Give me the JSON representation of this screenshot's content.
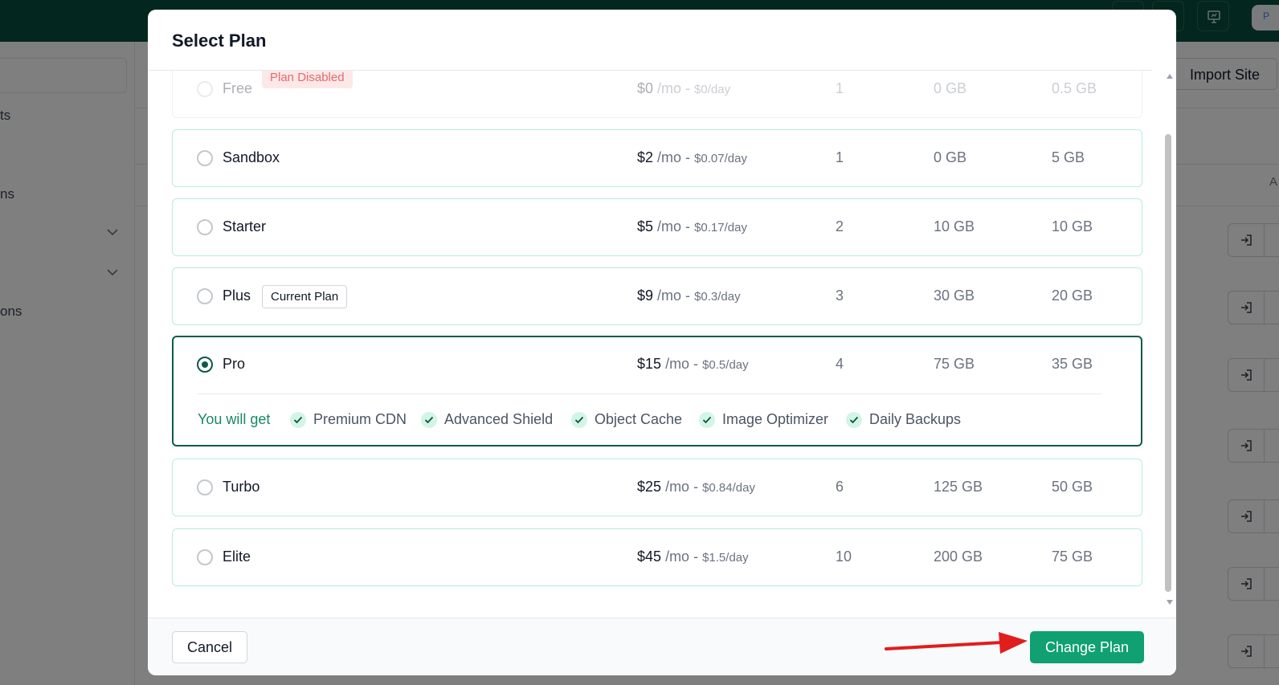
{
  "background": {
    "topbar": {
      "avatar_initial": "P"
    },
    "sidebar": {
      "items": [
        {
          "label": "ts"
        },
        {
          "label": "ns"
        },
        {
          "label": "ons"
        }
      ]
    },
    "header": {
      "import_label": "Import Site"
    },
    "table": {
      "column_fragment": "A"
    }
  },
  "modal": {
    "title": "Select Plan",
    "plans": [
      {
        "name": "Free",
        "badge": "Plan Disabled",
        "price": "$0",
        "per": "/mo - ",
        "day": "$0/day",
        "v1": "1",
        "v2": "0 GB",
        "v3": "0.5 GB"
      },
      {
        "name": "Sandbox",
        "price": "$2",
        "per": "/mo - ",
        "day": "$0.07/day",
        "v1": "1",
        "v2": "0 GB",
        "v3": "5 GB"
      },
      {
        "name": "Starter",
        "price": "$5",
        "per": "/mo - ",
        "day": "$0.17/day",
        "v1": "2",
        "v2": "10 GB",
        "v3": "10 GB"
      },
      {
        "name": "Plus",
        "badge": "Current Plan",
        "price": "$9",
        "per": "/mo - ",
        "day": "$0.3/day",
        "v1": "3",
        "v2": "30 GB",
        "v3": "20 GB"
      },
      {
        "name": "Pro",
        "price": "$15",
        "per": "/mo - ",
        "day": "$0.5/day",
        "v1": "4",
        "v2": "75 GB",
        "v3": "35 GB",
        "you_will_get": "You will get",
        "features": [
          "Premium CDN",
          "Advanced Shield",
          "Object Cache",
          "Image Optimizer",
          "Daily Backups"
        ]
      },
      {
        "name": "Turbo",
        "price": "$25",
        "per": "/mo - ",
        "day": "$0.84/day",
        "v1": "6",
        "v2": "125 GB",
        "v3": "50 GB"
      },
      {
        "name": "Elite",
        "price": "$45",
        "per": "/mo - ",
        "day": "$1.5/day",
        "v1": "10",
        "v2": "200 GB",
        "v3": "75 GB"
      }
    ],
    "selected_plan": "Pro",
    "cancel_label": "Cancel",
    "change_label": "Change Plan"
  },
  "colors": {
    "topbar": "#074d3e",
    "accent": "#10a072",
    "selected_border": "#0b5a49",
    "annotation_arrow": "#e11d1d"
  },
  "icons": [
    "presentation-icon",
    "chevron-down-icon",
    "login-icon",
    "check-icon",
    "radio-icon",
    "arrow-annotation"
  ]
}
